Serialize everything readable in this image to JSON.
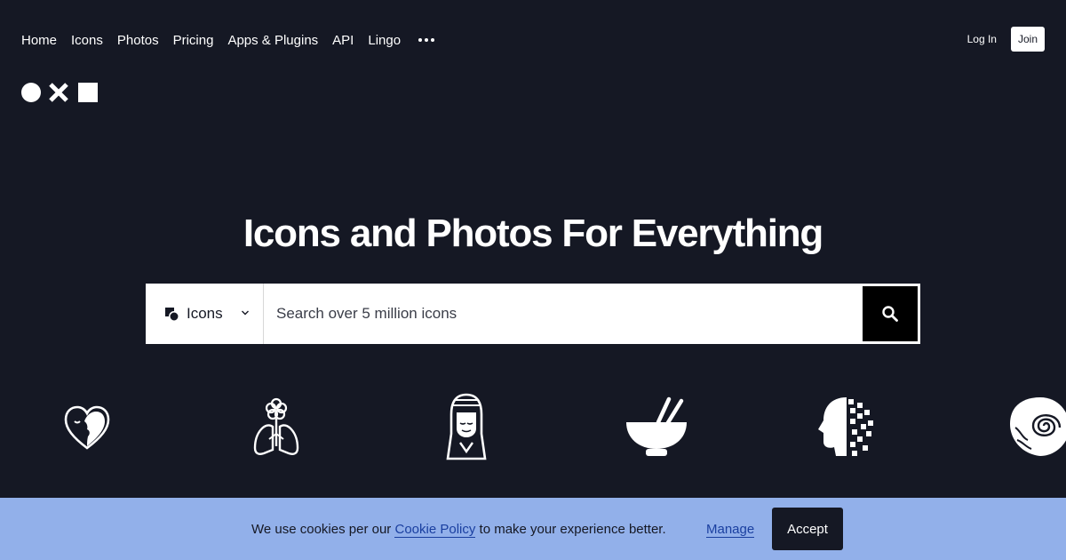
{
  "nav": {
    "items": [
      {
        "label": "Home"
      },
      {
        "label": "Icons"
      },
      {
        "label": "Photos"
      },
      {
        "label": "Pricing"
      },
      {
        "label": "Apps & Plugins"
      },
      {
        "label": "API"
      },
      {
        "label": "Lingo"
      }
    ],
    "more_icon": "more-dots-icon",
    "login_label": "Log In",
    "join_label": "Join"
  },
  "logo": {
    "icon": "noun-project-logo"
  },
  "hero": {
    "title": "Icons and Photos For Everything",
    "search": {
      "type_label": "Icons",
      "type_icon": "icons-category-icon",
      "placeholder": "Search over 5 million icons",
      "value": "",
      "button_icon": "search-icon"
    }
  },
  "showcase_icons": [
    "heart-face-icon",
    "lungs-flower-icon",
    "woman-portrait-icon",
    "mortar-pestle-bowl-icon",
    "pixel-head-icon",
    "spiral-brain-icon"
  ],
  "cookie_banner": {
    "text_before": "We use cookies per our ",
    "link_label": "Cookie Policy",
    "text_after": " to make your experience better.",
    "manage_label": "Manage",
    "accept_label": "Accept"
  },
  "colors": {
    "background": "#151824",
    "banner": "#92b0ea",
    "link": "#1a3fa0"
  }
}
